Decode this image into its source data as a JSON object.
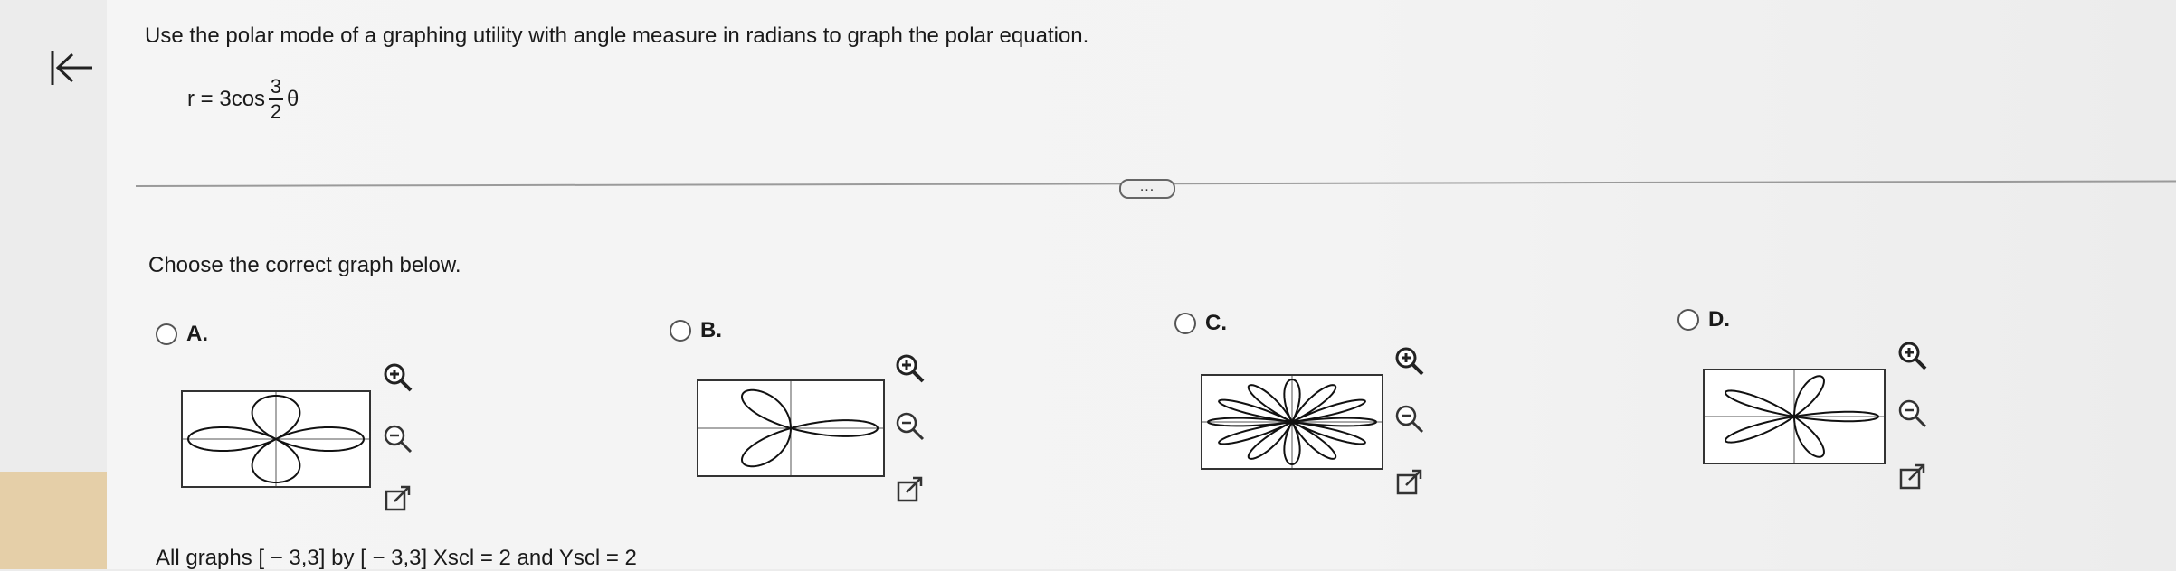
{
  "question": {
    "text": "Use the polar mode of a graphing utility with angle measure in radians to graph the polar equation.",
    "equation_lhs": "r = 3cos",
    "frac_num": "3",
    "frac_den": "2",
    "equation_var": "θ"
  },
  "more_button": "...",
  "prompt": "Choose the correct graph below.",
  "options": [
    {
      "letter": "A.",
      "petals": 4,
      "selected": false
    },
    {
      "letter": "B.",
      "petals": 6,
      "selected": false
    },
    {
      "letter": "C.",
      "petals": 12,
      "selected": false
    },
    {
      "letter": "D.",
      "petals": 10,
      "selected": false
    }
  ],
  "footer": "All graphs [ − 3,3] by [ − 3,3] Xscl = 2 and Yscl = 2",
  "icons": [
    "back-icon",
    "zoom-in-icon",
    "zoom-out-icon",
    "external-link-icon"
  ]
}
